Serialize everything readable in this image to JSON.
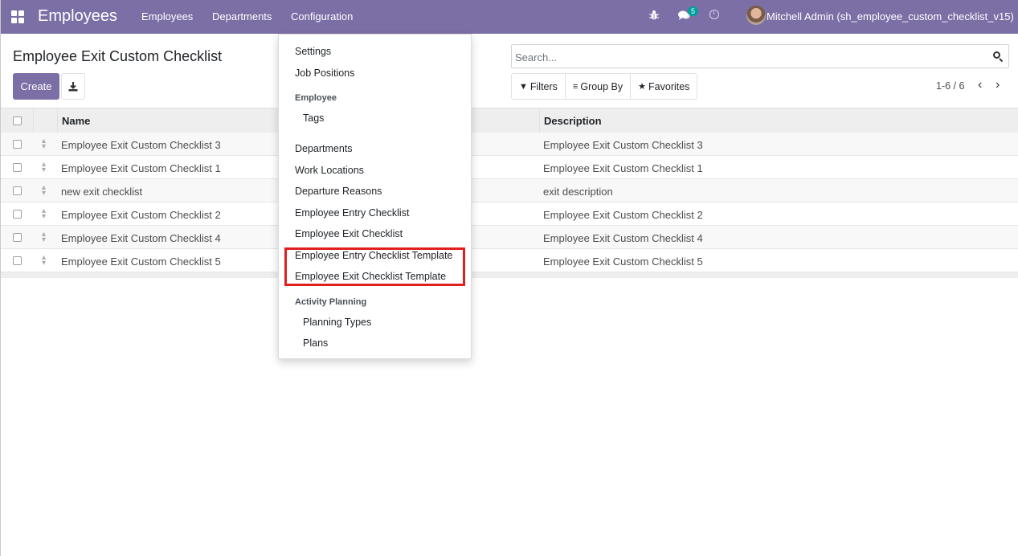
{
  "navbar": {
    "brand": "Employees",
    "menus": [
      "Employees",
      "Departments",
      "Configuration"
    ],
    "chat_badge": "5",
    "user": "Mitchell Admin (sh_employee_custom_checklist_v15)",
    "color": "#7c6fa6"
  },
  "control_panel": {
    "title": "Employee Exit Custom Checklist",
    "create_label": "Create",
    "search_placeholder": "Search...",
    "filters_label": "Filters",
    "groupby_label": "Group By",
    "favorites_label": "Favorites",
    "pager": "1-6 / 6"
  },
  "table": {
    "headers": [
      "Name",
      "Description"
    ],
    "rows": [
      {
        "name": "Employee Exit Custom Checklist 3",
        "description": "Employee Exit Custom Checklist 3"
      },
      {
        "name": "Employee Exit Custom Checklist 1",
        "description": "Employee Exit Custom Checklist 1"
      },
      {
        "name": "new exit checklist",
        "description": "exit description"
      },
      {
        "name": "Employee Exit Custom Checklist 2",
        "description": "Employee Exit Custom Checklist 2"
      },
      {
        "name": "Employee Exit Custom Checklist 4",
        "description": "Employee Exit Custom Checklist 4"
      },
      {
        "name": "Employee Exit Custom Checklist 5",
        "description": "Employee Exit Custom Checklist 5"
      }
    ]
  },
  "dropdown": {
    "settings": "Settings",
    "job_positions": "Job Positions",
    "employee_header": "Employee",
    "tags": "Tags",
    "departments": "Departments",
    "work_locations": "Work Locations",
    "departure_reasons": "Departure Reasons",
    "entry_checklist": "Employee Entry Checklist",
    "exit_checklist": "Employee Exit Checklist",
    "entry_template": "Employee Entry Checklist Template",
    "exit_template": "Employee Exit Checklist Template",
    "activity_header": "Activity Planning",
    "planning_types": "Planning Types",
    "plans": "Plans"
  },
  "highlight_color": "#e01f1f"
}
